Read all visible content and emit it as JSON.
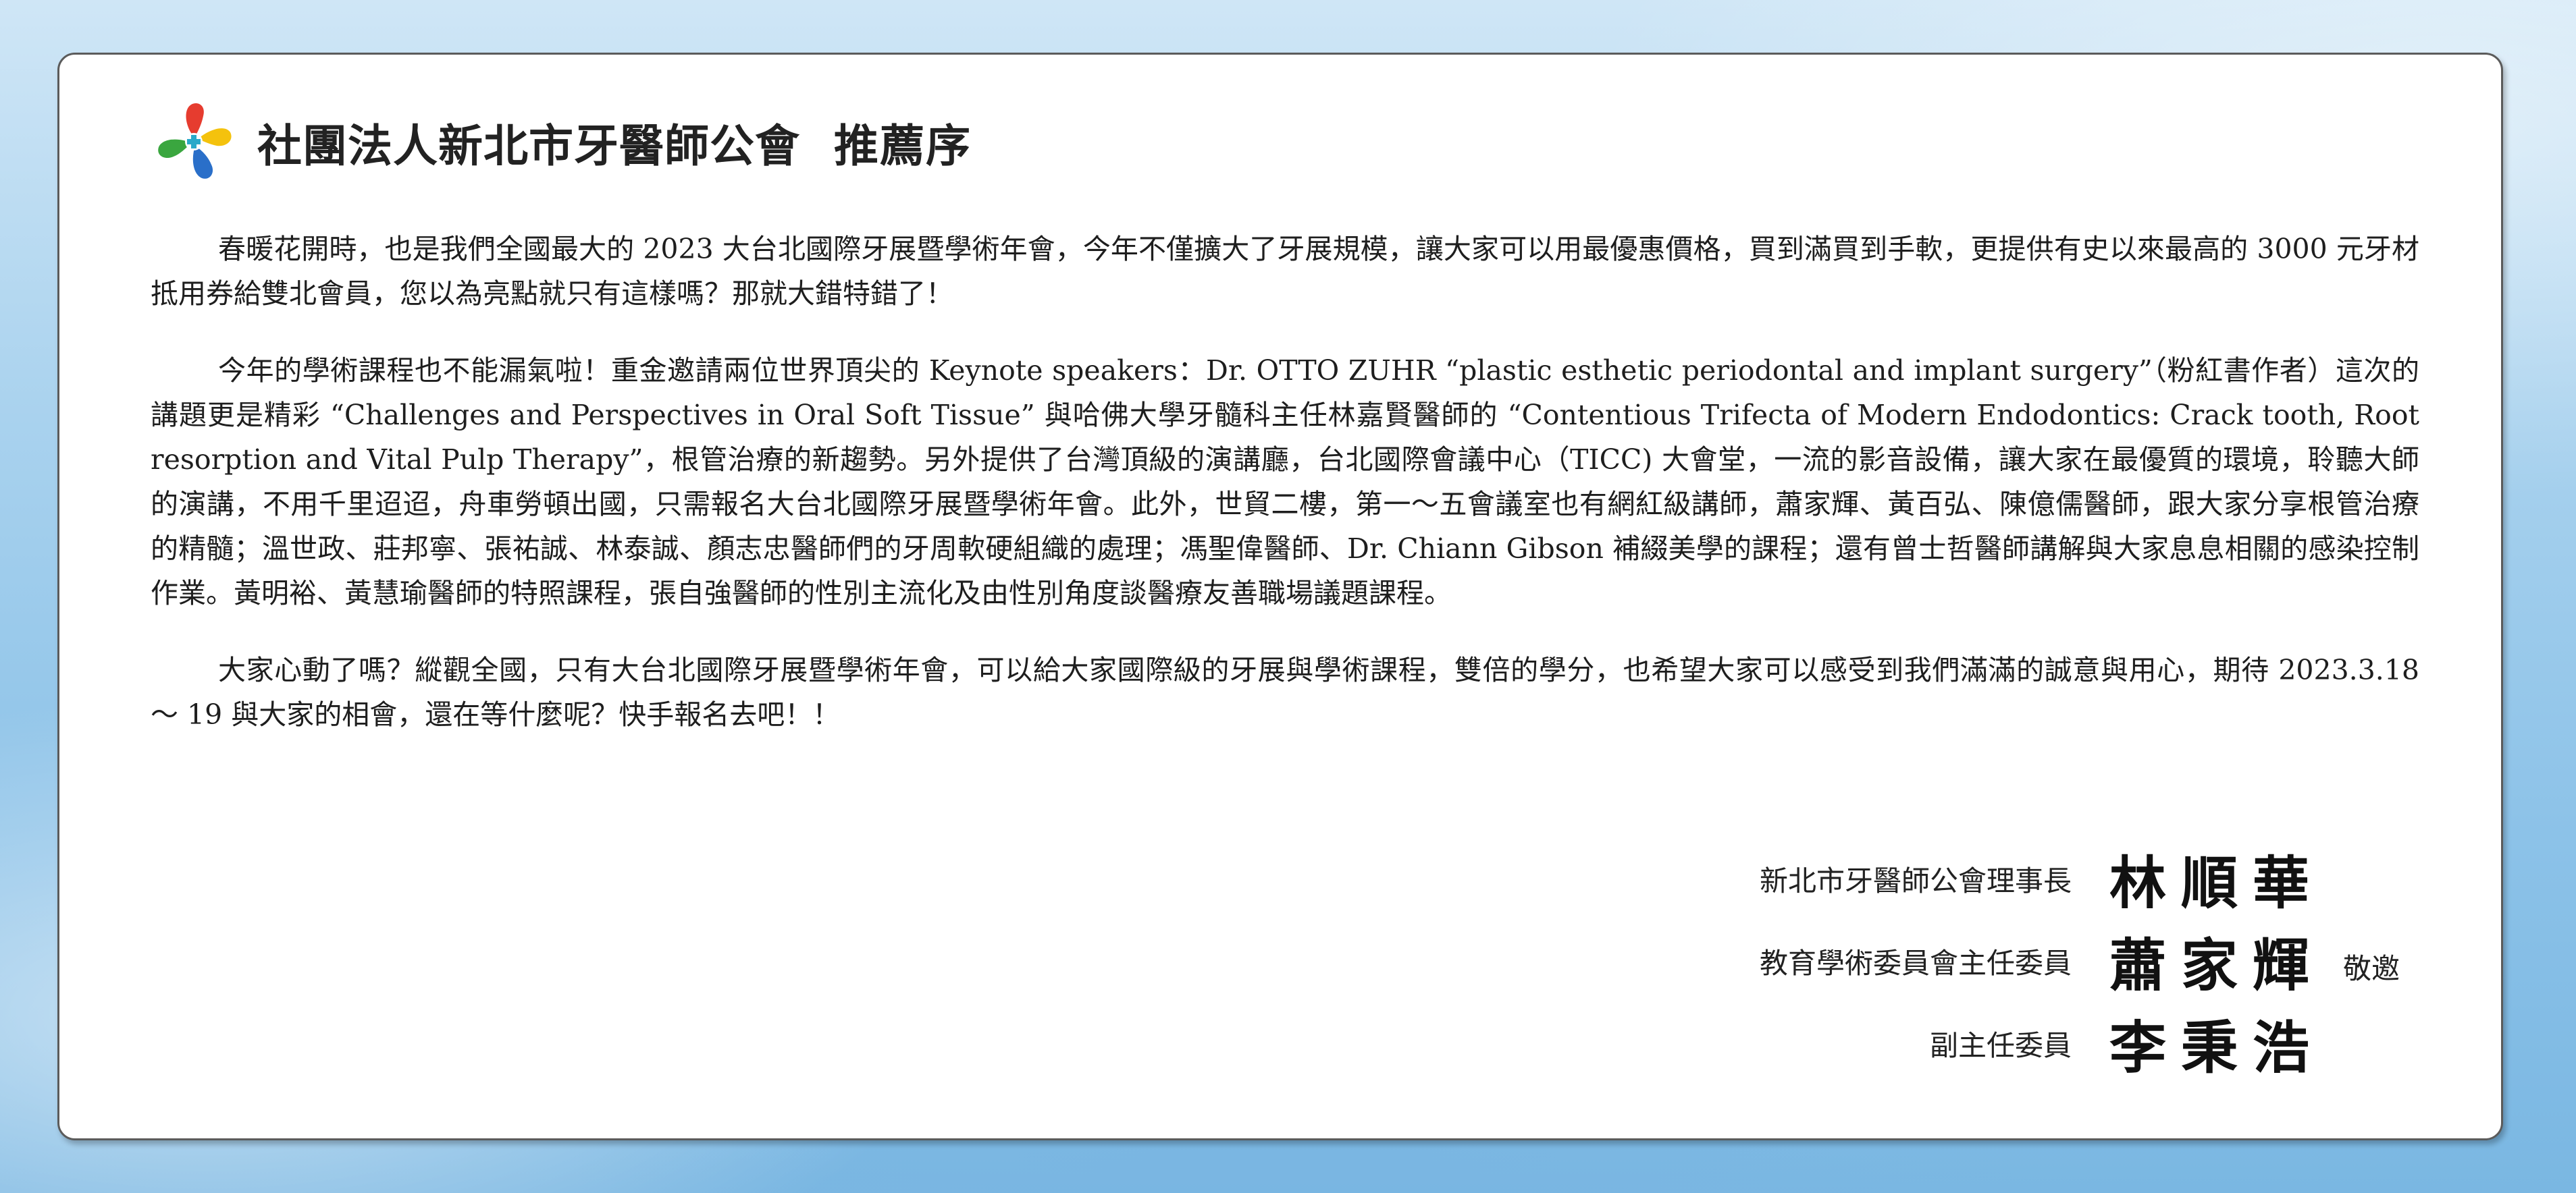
{
  "header": {
    "org_name": "社團法人新北市牙醫師公會",
    "doc_title": "推薦序"
  },
  "logo": {
    "icon": "clover-tooth-logo-icon",
    "colors": [
      "#e63c2f",
      "#f4c20d",
      "#3aa63f",
      "#2a6fc9"
    ]
  },
  "paragraphs": [
    "春暖花開時，也是我們全國最大的 2023 大台北國際牙展暨學術年會，今年不僅擴大了牙展規模，讓大家可以用最優惠價格，買到滿買到手軟，更提供有史以來最高的 3000 元牙材抵用券給雙北會員，您以為亮點就只有這樣嗎？那就大錯特錯了！",
    "今年的學術課程也不能漏氣啦！重金邀請兩位世界頂尖的 Keynote speakers：Dr. OTTO ZUHR “plastic esthetic periodontal and implant surgery”（粉紅書作者）這次的講題更是精彩 “Challenges and Perspectives in Oral Soft Tissue” 與哈佛大學牙髓科主任林嘉賢醫師的 “Contentious Trifecta of Modern Endodontics: Crack tooth, Root resorption and Vital Pulp Therapy”，根管治療的新趨勢。另外提供了台灣頂級的演講廳，台北國際會議中心（TICC) 大會堂，一流的影音設備，讓大家在最優質的環境，聆聽大師的演講，不用千里迢迢，舟車勞頓出國，只需報名大台北國際牙展暨學術年會。此外，世貿二樓，第一～五會議室也有網紅級講師，蕭家輝、黃百弘、陳億儒醫師，跟大家分享根管治療的精髓；溫世政、莊邦寧、張祐誠、林泰誠、顏志忠醫師們的牙周軟硬組織的處理；馮聖偉醫師、Dr. Chiann Gibson 補綴美學的課程；還有曾士哲醫師講解與大家息息相關的感染控制作業。黃明裕、黃慧瑜醫師的特照課程，張自強醫師的性別主流化及由性別角度談醫療友善職場議題課程。",
    "大家心動了嗎？縱觀全國，只有大台北國際牙展暨學術年會，可以給大家國際級的牙展與學術課程，雙倍的學分，也希望大家可以感受到我們滿滿的誠意與用心，期待 2023.3.18 ～ 19 與大家的相會，還在等什麼呢？快手報名去吧！！"
  ],
  "signatures": [
    {
      "title": "新北市牙醫師公會理事長",
      "name": "林順華",
      "suffix": ""
    },
    {
      "title": "教育學術委員會主任委員",
      "name": "蕭家輝",
      "suffix": "敬邀"
    },
    {
      "title": "副主任委員",
      "name": "李秉浩",
      "suffix": ""
    }
  ]
}
